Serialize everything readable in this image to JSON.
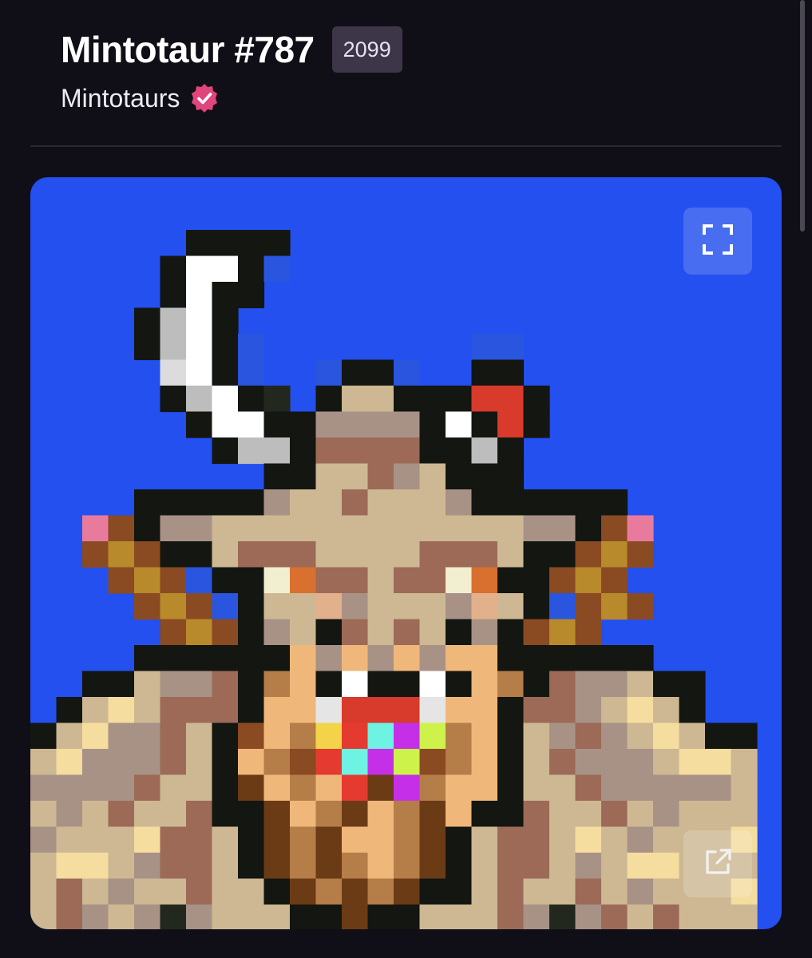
{
  "nft": {
    "title": "Mintotaur #787",
    "rank": "2099",
    "collection": "Mintotaurs",
    "verified": true
  },
  "artwork": {
    "background_color": "#2350ef",
    "controls": {
      "fullscreen_icon": "fullscreen-icon",
      "external_icon": "external-link-icon"
    }
  },
  "colors": {
    "page_background": "#100e17",
    "badge_background": "#3d3548",
    "verified_badge": "#e0457b"
  }
}
